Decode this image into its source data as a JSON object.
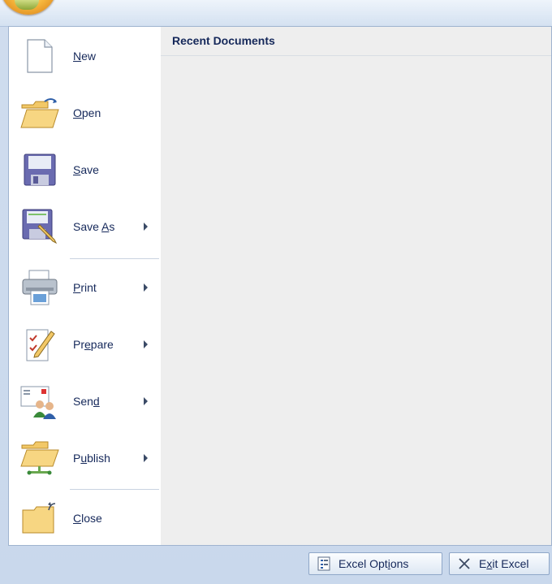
{
  "menu": {
    "items": [
      {
        "label": "New",
        "key": "N",
        "rest": "ew",
        "icon": "new-document-icon",
        "has_submenu": false
      },
      {
        "label": "Open",
        "key": "O",
        "rest": "pen",
        "icon": "open-folder-icon",
        "has_submenu": false
      },
      {
        "label": "Save",
        "key": "S",
        "rest": "ave",
        "icon": "save-floppy-icon",
        "has_submenu": false
      },
      {
        "label": "Save As",
        "pre": "Save ",
        "key": "A",
        "rest": "s",
        "icon": "save-as-icon",
        "has_submenu": true
      },
      {
        "label": "Print",
        "key": "P",
        "rest": "rint",
        "icon": "printer-icon",
        "has_submenu": true
      },
      {
        "label": "Prepare",
        "pre": "Pr",
        "key": "e",
        "rest": "pare",
        "icon": "prepare-document-icon",
        "has_submenu": true
      },
      {
        "label": "Send",
        "pre": "Sen",
        "key": "d",
        "rest": "",
        "icon": "send-mail-icon",
        "has_submenu": true
      },
      {
        "label": "Publish",
        "pre": "P",
        "key": "u",
        "rest": "blish",
        "icon": "publish-folder-icon",
        "has_submenu": true
      },
      {
        "label": "Close",
        "key": "C",
        "rest": "lose",
        "icon": "close-folder-icon",
        "has_submenu": false
      }
    ]
  },
  "recent": {
    "title": "Recent Documents"
  },
  "footer": {
    "options_label_pre": "Excel Opt",
    "options_label_key": "i",
    "options_label_post": "ons",
    "exit_label_pre": "E",
    "exit_label_key": "x",
    "exit_label_post": "it Excel"
  }
}
